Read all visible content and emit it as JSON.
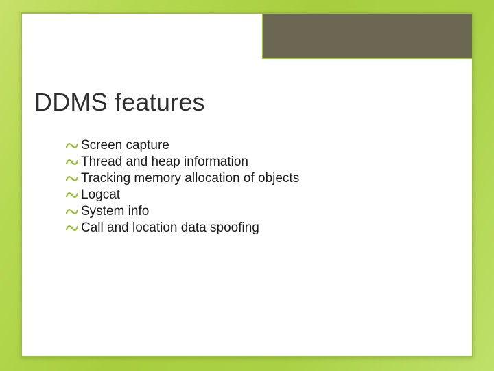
{
  "title": "DDMS features",
  "bullets": [
    "Screen capture",
    "Thread and heap information",
    "Tracking memory allocation of objects",
    "Logcat",
    "System info",
    "Call and location data spoofing"
  ],
  "colors": {
    "accent": "#9bbf3b",
    "corner": "#6b6753",
    "bg_start": "#c7e06a",
    "bg_end": "#a8ce3f"
  }
}
